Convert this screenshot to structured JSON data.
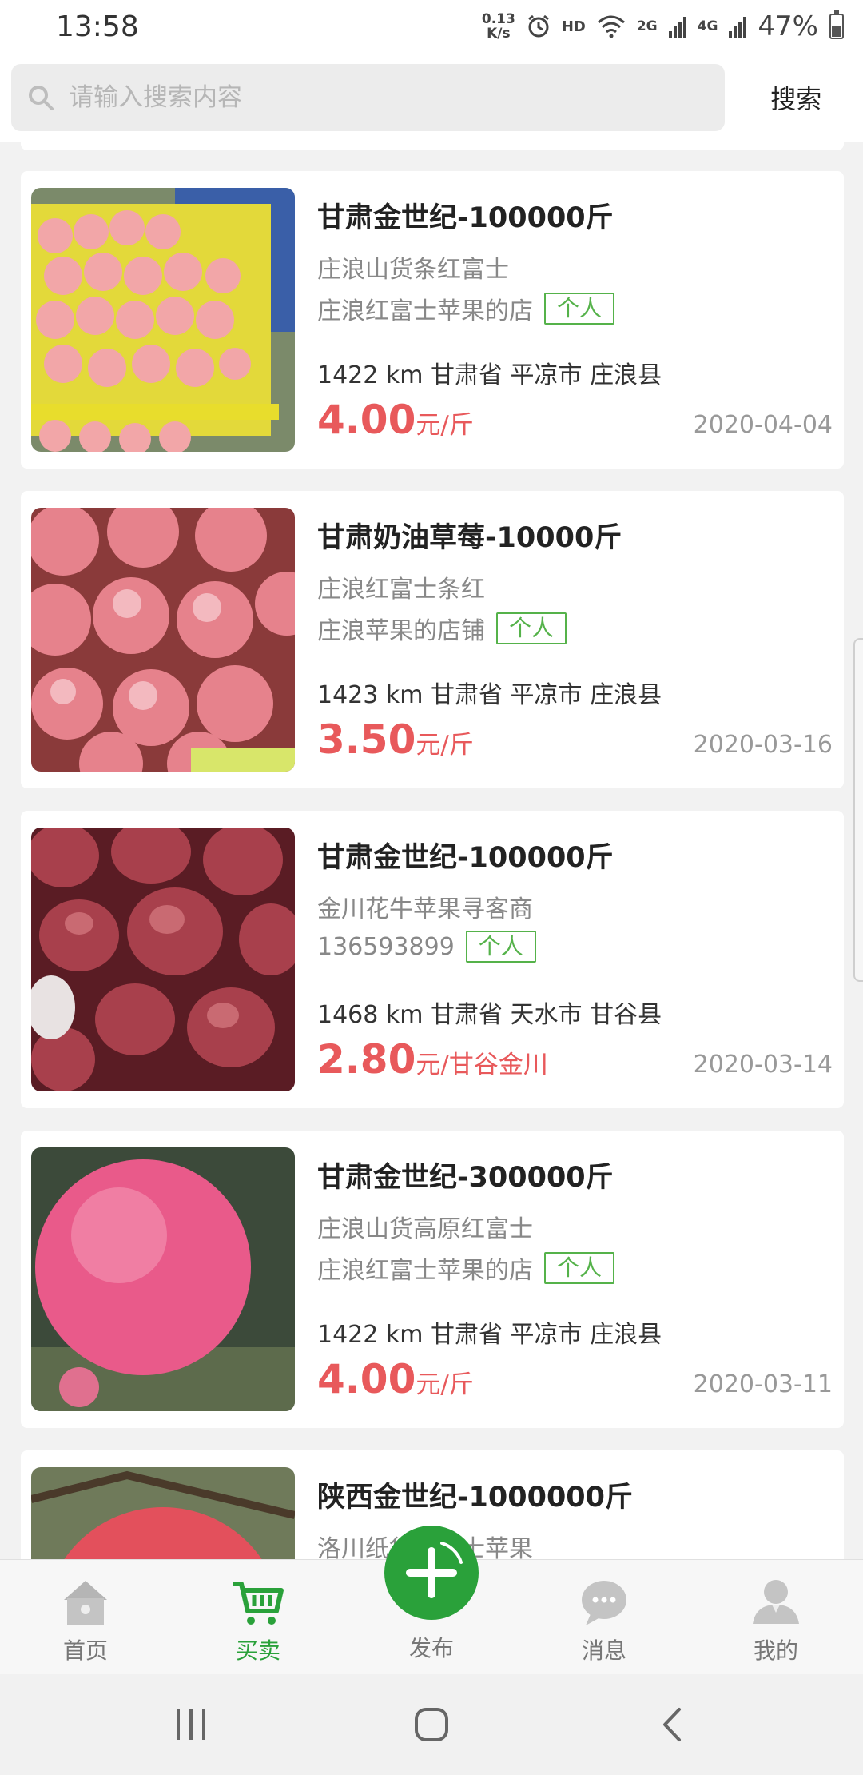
{
  "status_bar": {
    "time": "13:58",
    "net_speed_top": "0.13",
    "net_speed_bottom": "K/s",
    "hd": "HD",
    "signal_1": "2G",
    "signal_2": "4G",
    "battery": "47%"
  },
  "search": {
    "placeholder": "请输入搜索内容",
    "button_label": "搜索"
  },
  "listings": [
    {
      "title": "甘肃金世纪-100000斤",
      "subtitle": "庄浪山货条红富士",
      "shop": "庄浪红富士苹果的店",
      "badge": "个人",
      "location": "1422 km  甘肃省 平凉市 庄浪县",
      "price": "4.00",
      "unit": "元/斤",
      "date": "2020-04-04"
    },
    {
      "title": "甘肃奶油草莓-10000斤",
      "subtitle": "庄浪红富士条红",
      "shop": "庄浪苹果的店铺",
      "badge": "个人",
      "location": "1423 km  甘肃省 平凉市 庄浪县",
      "price": "3.50",
      "unit": "元/斤",
      "date": "2020-03-16"
    },
    {
      "title": "甘肃金世纪-100000斤",
      "subtitle": "金川花牛苹果寻客商",
      "shop": "136593899",
      "badge": "个人",
      "location": "1468 km  甘肃省 天水市 甘谷县",
      "price": "2.80",
      "unit": "元/甘谷金川",
      "date": "2020-03-14"
    },
    {
      "title": "甘肃金世纪-300000斤",
      "subtitle": "庄浪山货高原红富士",
      "shop": "庄浪红富士苹果的店",
      "badge": "个人",
      "location": "1422 km  甘肃省 平凉市 庄浪县",
      "price": "4.00",
      "unit": "元/斤",
      "date": "2020-03-11"
    },
    {
      "title": "陕西金世纪-1000000斤",
      "subtitle": "洛川纸袋红富士苹果"
    }
  ],
  "bottom_nav": {
    "home": "首页",
    "trade": "买卖",
    "publish": "发布",
    "messages": "消息",
    "mine": "我的",
    "active": "trade"
  },
  "colors": {
    "accent_green": "#2aa13a",
    "price_red": "#e8595b",
    "badge_green": "#55b24a"
  }
}
